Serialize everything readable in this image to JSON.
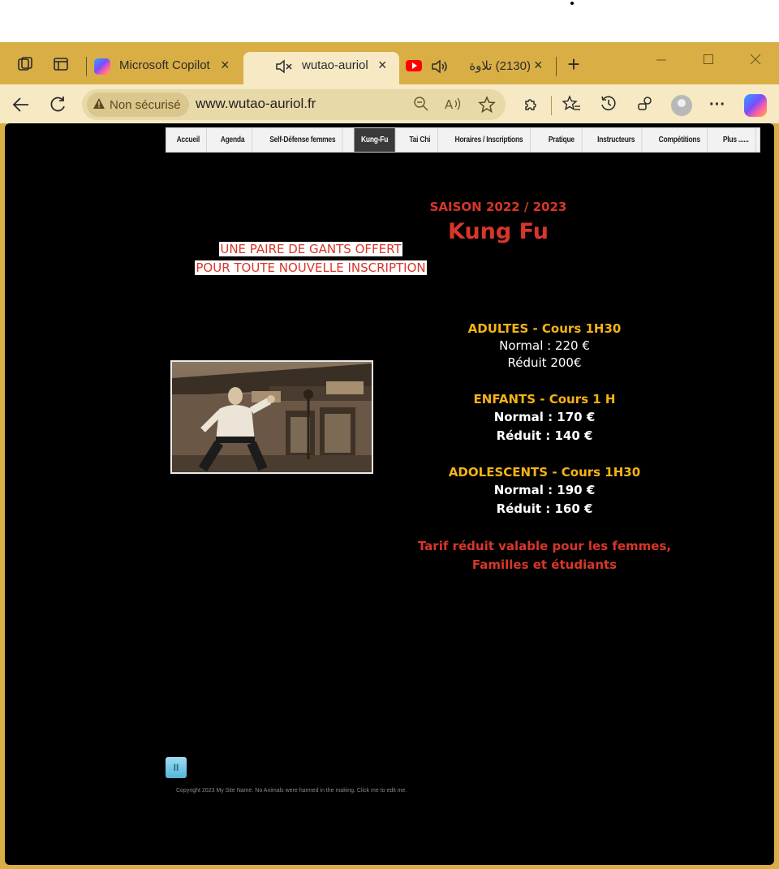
{
  "browser": {
    "tabs": [
      {
        "label": "Microsoft Copilot",
        "close": "×"
      },
      {
        "label": "wutao-auriol",
        "close": "×"
      },
      {
        "label": "(2130) تلاوة",
        "close": "×"
      }
    ],
    "new_tab": "+",
    "address": {
      "security_label": "Non sécurisé",
      "url": "www.wutao-auriol.fr"
    }
  },
  "site": {
    "menu": [
      {
        "label": "Accueil"
      },
      {
        "label": "Agenda"
      },
      {
        "label": "Self-Défense femmes"
      },
      {
        "label": "Kung-Fu"
      },
      {
        "label": "Tai Chi"
      },
      {
        "label": "Horaires / Inscriptions"
      },
      {
        "label": "Pratique"
      },
      {
        "label": "Instructeurs"
      },
      {
        "label": "Compétitions"
      },
      {
        "label": "Plus ......"
      }
    ],
    "season": "SAISON 2022 / 2023",
    "title": "Kung Fu",
    "promo_line1": "UNE PAIRE DE GANTS OFFERT",
    "promo_line2": "POUR TOUTE NOUVELLE INSCRIPTION",
    "adults": {
      "heading": "ADULTES - Cours 1H30",
      "normal": "Normal : 220 €",
      "reduit": "Réduit 200€"
    },
    "children": {
      "heading": "ENFANTS  - Cours 1 H",
      "normal": "Normal : 170 €",
      "reduit": "Réduit : 140 €"
    },
    "teens": {
      "heading": "ADOLESCENTS - Cours 1H30",
      "normal": "Normal : 190 €",
      "reduit": "Réduit : 160 €"
    },
    "reduction_note_line1": "Tarif réduit valable pour les femmes,",
    "reduction_note_line2": "Familles et étudiants",
    "pause_label": "II",
    "copyright": "Copyright 2023 My Site Name. No Animals were harmed in the making. Click me to edit me."
  },
  "colors": {
    "browser_frame": "#d9ae45",
    "accent_red": "#d8362a",
    "accent_gold": "#f5b316"
  }
}
